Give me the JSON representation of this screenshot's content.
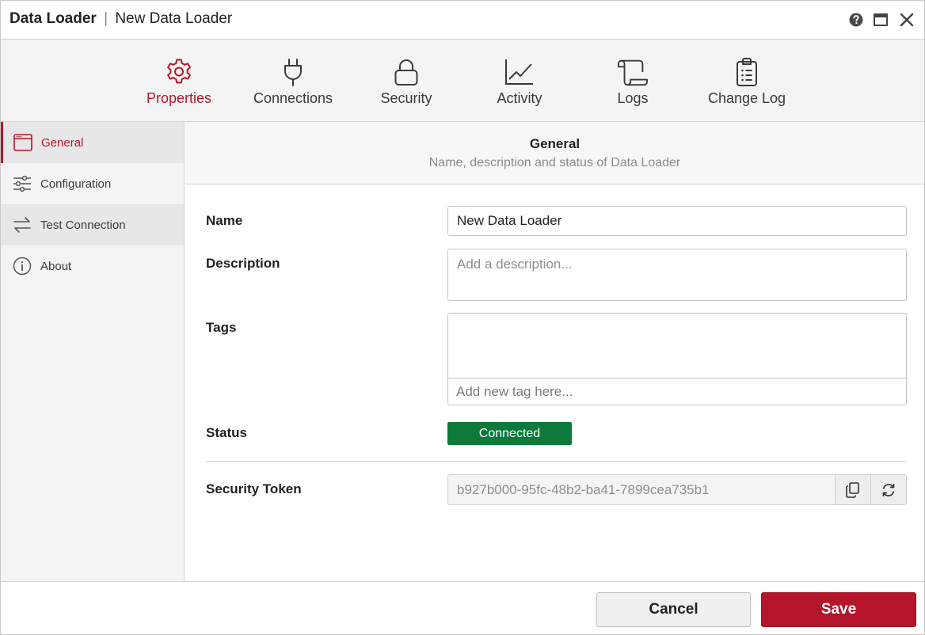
{
  "window": {
    "app_name": "Data Loader",
    "separator": "|",
    "item_name": "New Data Loader"
  },
  "topnav": {
    "items": [
      {
        "label": "Properties",
        "icon": "gear-icon",
        "active": true
      },
      {
        "label": "Connections",
        "icon": "plug-icon"
      },
      {
        "label": "Security",
        "icon": "lock-icon"
      },
      {
        "label": "Activity",
        "icon": "chart-icon"
      },
      {
        "label": "Logs",
        "icon": "scroll-icon"
      },
      {
        "label": "Change Log",
        "icon": "clipboard-icon"
      }
    ]
  },
  "sidebar": {
    "items": [
      {
        "label": "General",
        "icon": "window-icon",
        "active": true
      },
      {
        "label": "Configuration",
        "icon": "sliders-icon"
      },
      {
        "label": "Test Connection",
        "icon": "arrows-swap-icon"
      },
      {
        "label": "About",
        "icon": "info-icon"
      }
    ]
  },
  "section": {
    "title": "General",
    "subtitle": "Name, description and status of Data Loader"
  },
  "form": {
    "name_label": "Name",
    "name_value": "New Data Loader",
    "description_label": "Description",
    "description_placeholder": "Add a description...",
    "tags_label": "Tags",
    "tags_placeholder": "Add new tag here...",
    "status_label": "Status",
    "status_value": "Connected",
    "token_label": "Security Token",
    "token_value": "b927b000-95fc-48b2-ba41-7899cea735b1"
  },
  "footer": {
    "cancel_label": "Cancel",
    "save_label": "Save"
  },
  "colors": {
    "accent": "#b5152b",
    "status_connected": "#0b7a3a"
  }
}
